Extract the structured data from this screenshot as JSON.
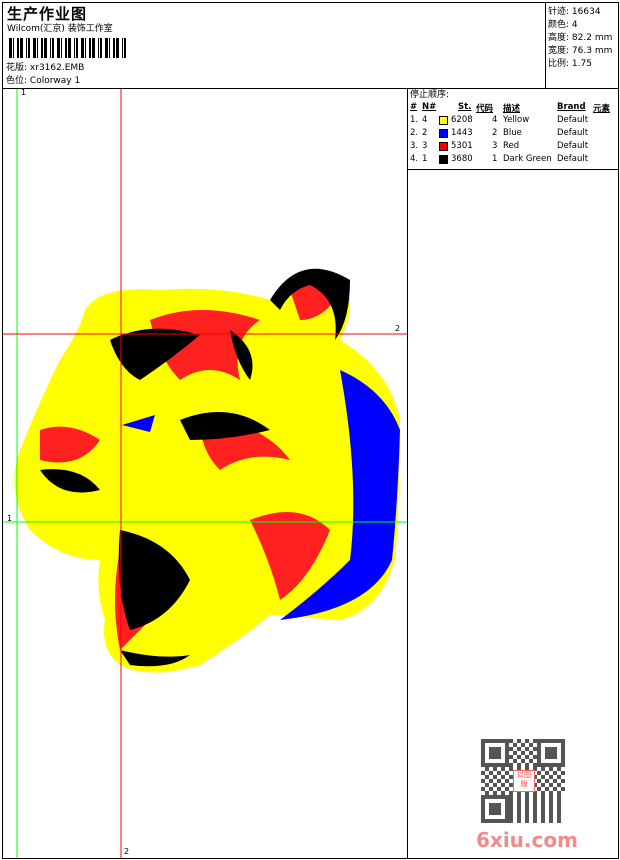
{
  "header": {
    "title": "生产作业图",
    "company": "Wilcom(汇京) 装饰工作室",
    "design_label": "花版:",
    "design_value": "xr3162.EMB",
    "colorway_label": "色位:",
    "colorway_value": "Colorway 1"
  },
  "stats": [
    {
      "label": "针迹:",
      "value": "16634"
    },
    {
      "label": "颜色:",
      "value": "4"
    },
    {
      "label": "高度:",
      "value": "82.2 mm"
    },
    {
      "label": "宽度:",
      "value": "76.3 mm"
    },
    {
      "label": "比例:",
      "value": "1.75"
    }
  ],
  "stop_sequence": {
    "title": "停止顺序:",
    "columns": [
      "#",
      "N#",
      "St.",
      "代码",
      "描述",
      "Brand",
      "元素"
    ],
    "rows": [
      {
        "idx": "1.",
        "n": "4",
        "color": "#ffff00",
        "st": "6208",
        "code": "4",
        "desc": "Yellow",
        "brand": "Default"
      },
      {
        "idx": "2.",
        "n": "2",
        "color": "#0000ff",
        "st": "1443",
        "code": "2",
        "desc": "Blue",
        "brand": "Default"
      },
      {
        "idx": "3.",
        "n": "3",
        "color": "#ff0000",
        "st": "5301",
        "code": "3",
        "desc": "Red",
        "brand": "Default"
      },
      {
        "idx": "4.",
        "n": "1",
        "color": "#000000",
        "st": "3680",
        "code": "1",
        "desc": "Dark Green",
        "brand": "Default"
      }
    ]
  },
  "guides": {
    "green_label": "1",
    "red_label": "2",
    "green": "#00ff00",
    "red": "#ff0000"
  },
  "watermark": {
    "site": "6xiu.com",
    "stamp": "以图版"
  }
}
